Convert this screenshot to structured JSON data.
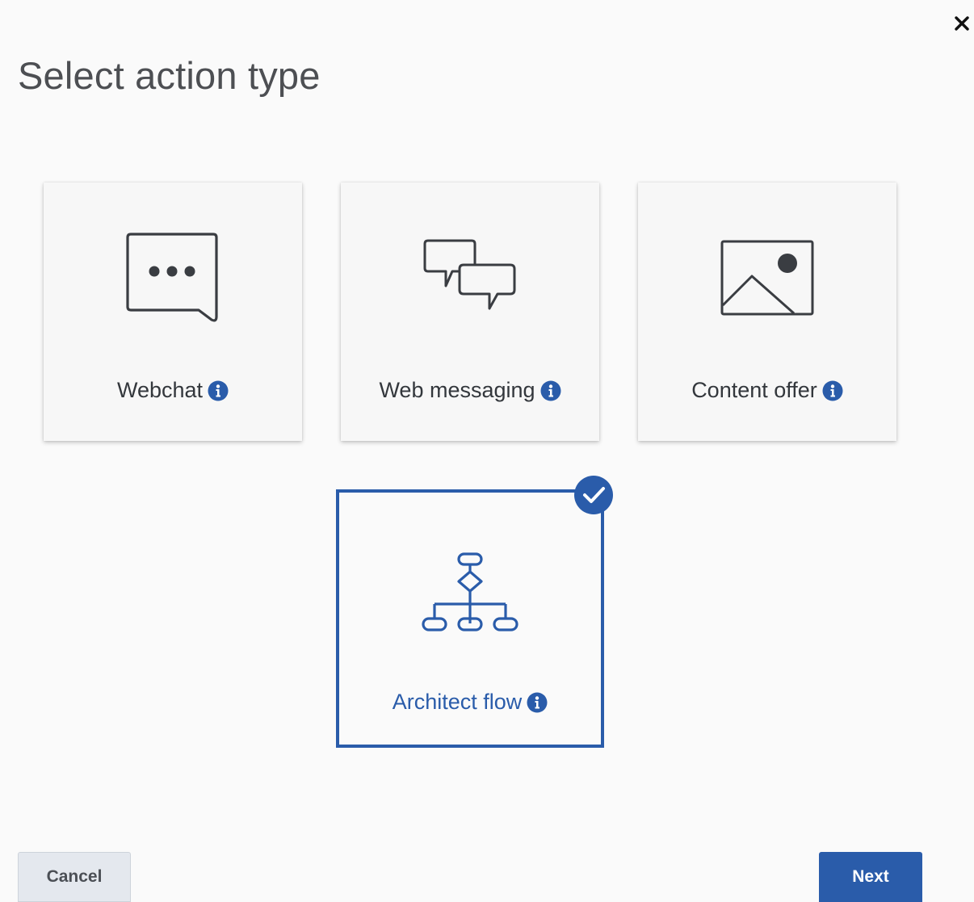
{
  "dialog": {
    "title": "Select action type",
    "close_icon": "close-icon"
  },
  "cards": [
    {
      "label": "Webchat",
      "icon": "chat-bubble-dots-icon",
      "selected": false
    },
    {
      "label": "Web messaging",
      "icon": "two-chat-bubbles-icon",
      "selected": false
    },
    {
      "label": "Content offer",
      "icon": "image-icon",
      "selected": false
    },
    {
      "label": "Architect flow",
      "icon": "flowchart-icon",
      "selected": true
    }
  ],
  "footer": {
    "cancel_label": "Cancel",
    "next_label": "Next"
  },
  "colors": {
    "accent": "#2a5caa",
    "text": "#33373c",
    "title": "#4d4f53",
    "background": "#fafafa"
  }
}
